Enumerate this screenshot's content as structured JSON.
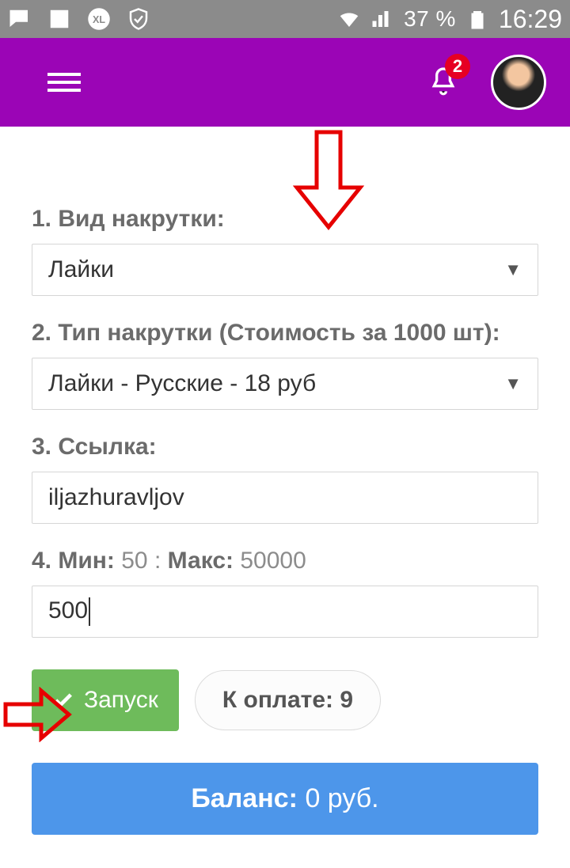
{
  "status": {
    "battery_pct": "37 %",
    "clock": "16:29"
  },
  "header": {
    "notification_count": "2"
  },
  "form": {
    "field1": {
      "label": "1. Вид накрутки:",
      "value": "Лайки"
    },
    "field2": {
      "label": "2. Тип накрутки (Стоимость за 1000 шт):",
      "value": "Лайки - Русские - 18 руб"
    },
    "field3": {
      "label": "3. Ссылка:",
      "value": "iljazhuravljov"
    },
    "field4": {
      "label_min": "4. Мин:",
      "min": "50",
      "sep": ":",
      "label_max": "Макс:",
      "max": "50000",
      "value": "500"
    },
    "launch_label": "Запуск",
    "topay_label": "К оплате:",
    "topay_value": "9",
    "balance_label": "Баланс:",
    "balance_value": "0 руб."
  }
}
